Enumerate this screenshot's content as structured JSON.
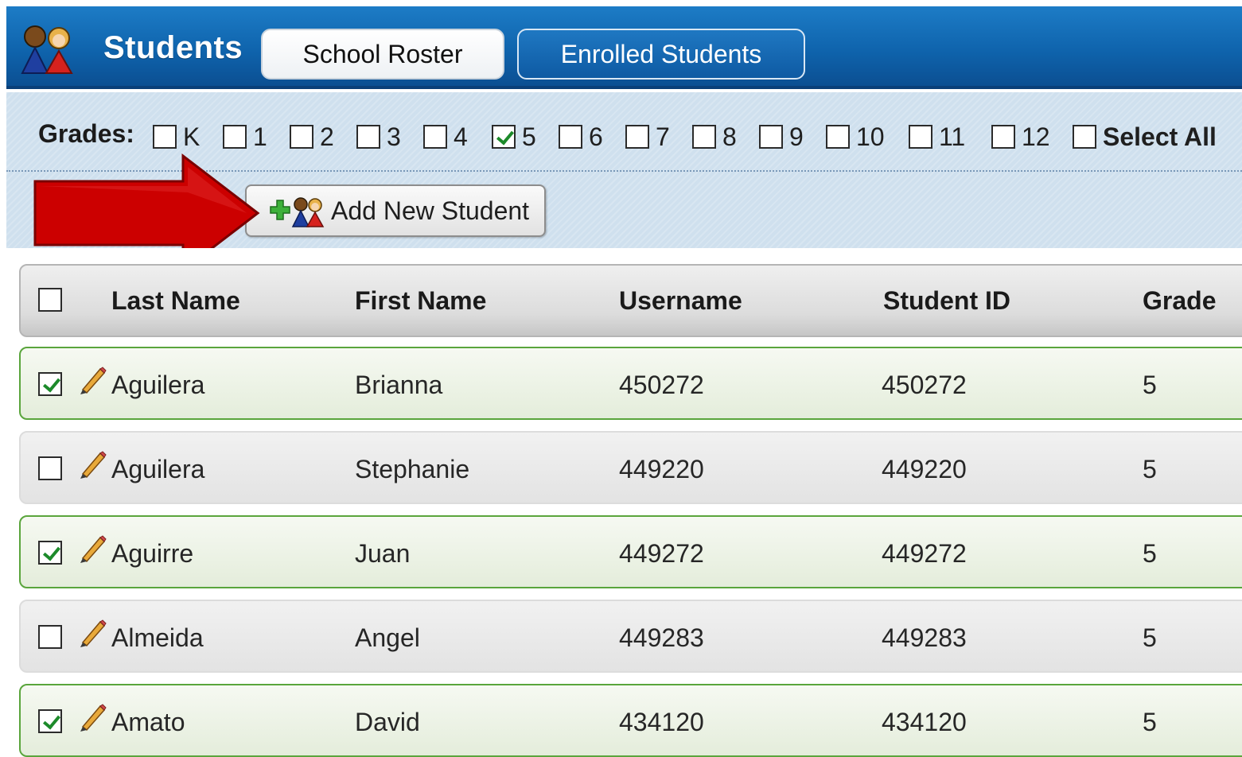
{
  "header": {
    "title": "Students",
    "icon": "students-group-icon",
    "tabs": [
      {
        "label": "School Roster",
        "active": false
      },
      {
        "label": "Enrolled Students",
        "active": true
      }
    ]
  },
  "filters": {
    "grades_label": "Grades:",
    "grades": [
      {
        "label": "K",
        "checked": false
      },
      {
        "label": "1",
        "checked": false
      },
      {
        "label": "2",
        "checked": false
      },
      {
        "label": "3",
        "checked": false
      },
      {
        "label": "4",
        "checked": false
      },
      {
        "label": "5",
        "checked": true
      },
      {
        "label": "6",
        "checked": false
      },
      {
        "label": "7",
        "checked": false
      },
      {
        "label": "8",
        "checked": false
      },
      {
        "label": "9",
        "checked": false
      },
      {
        "label": "10",
        "checked": false
      },
      {
        "label": "11",
        "checked": false
      },
      {
        "label": "12",
        "checked": false
      }
    ],
    "select_all_label": "Select All",
    "select_all_checked": false
  },
  "toolbar": {
    "add_student_label": "Add New Student"
  },
  "table": {
    "columns": [
      "Last Name",
      "First Name",
      "Username",
      "Student ID",
      "Grade"
    ],
    "rows": [
      {
        "checked": true,
        "last": "Aguilera",
        "first": "Brianna",
        "username": "450272",
        "student_id": "450272",
        "grade": "5"
      },
      {
        "checked": false,
        "last": "Aguilera",
        "first": "Stephanie",
        "username": "449220",
        "student_id": "449220",
        "grade": "5"
      },
      {
        "checked": true,
        "last": "Aguirre",
        "first": "Juan",
        "username": "449272",
        "student_id": "449272",
        "grade": "5"
      },
      {
        "checked": false,
        "last": "Almeida",
        "first": "Angel",
        "username": "449283",
        "student_id": "449283",
        "grade": "5"
      },
      {
        "checked": true,
        "last": "Amato",
        "first": "David",
        "username": "434120",
        "student_id": "434120",
        "grade": "5"
      }
    ]
  },
  "colors": {
    "header_blue": "#0f64ad",
    "panel_blue": "#cfe0ee",
    "selected_border": "#5aa53c",
    "check_green": "#1c8a2a",
    "annotation_arrow": "#cc0000"
  }
}
